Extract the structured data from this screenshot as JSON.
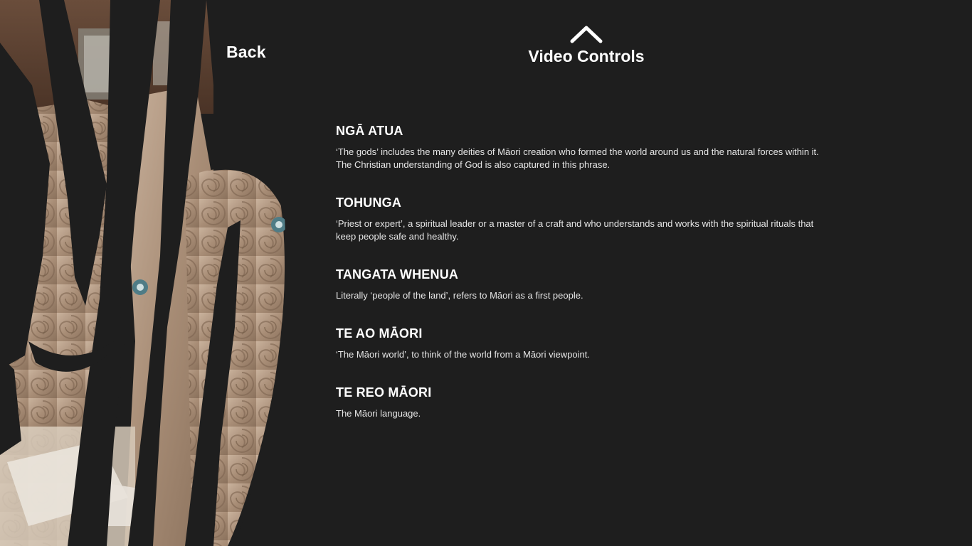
{
  "nav": {
    "back_label": "Back"
  },
  "video_controls": {
    "label": "Video Controls",
    "icon": "chevron-up-icon"
  },
  "background_art": {
    "description_icon": "carving-image"
  },
  "glossary": [
    {
      "title": "NGĀ ATUA",
      "lines": [
        "‘The gods’ includes the many deities of Māori creation who formed the world around us and the natural forces within it.",
        "The Christian understanding of God is also captured in this phrase."
      ]
    },
    {
      "title": "TOHUNGA",
      "lines": [
        "‘Priest or expert’, a spiritual leader or a master of a craft and who understands and works with the spiritual rituals that",
        "keep people safe and healthy."
      ]
    },
    {
      "title": "TANGATA WHENUA",
      "lines": [
        "Literally ‘people of the land’, refers to Māori as a first people."
      ]
    },
    {
      "title": "TE AO MĀORI",
      "lines": [
        "‘The Māori world’, to think of the world from a Māori viewpoint."
      ]
    },
    {
      "title": "TE REO MĀORI",
      "lines": [
        "The Māori language."
      ]
    }
  ],
  "colors": {
    "background": "#1e1e1e",
    "text": "#ffffff",
    "wood": "#b89d84"
  }
}
